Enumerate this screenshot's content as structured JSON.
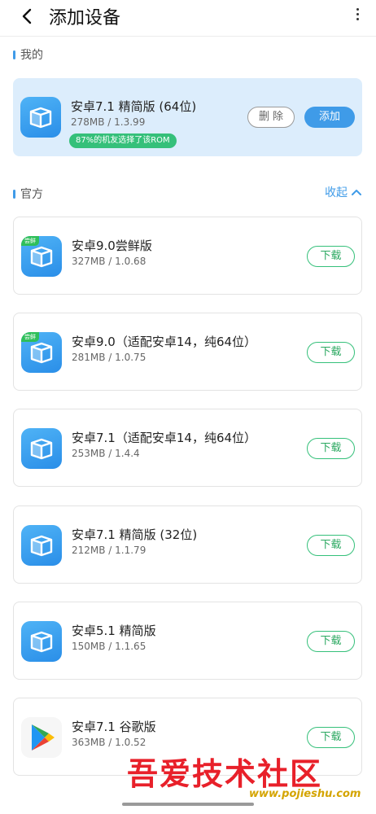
{
  "header": {
    "title": "添加设备"
  },
  "mine": {
    "section_label": "我的",
    "item": {
      "name": "安卓7.1 精简版 (64位)",
      "meta": "278MB / 1.3.99",
      "badge": "87%的机友选择了该ROM",
      "delete_label": "删除",
      "add_label": "添加"
    }
  },
  "official": {
    "section_label": "官方",
    "collapse_label": "收起",
    "beta_tag": "尝鲜",
    "download_label": "下载",
    "items": [
      {
        "name": "安卓9.0尝鲜版",
        "meta": "327MB / 1.0.68",
        "icon": "android-vm-beta-icon"
      },
      {
        "name": "安卓9.0（适配安卓14，纯64位）",
        "meta": "281MB / 1.0.75",
        "icon": "android-vm-beta-icon"
      },
      {
        "name": "安卓7.1（适配安卓14，纯64位）",
        "meta": "253MB / 1.4.4",
        "icon": "android-vm-icon"
      },
      {
        "name": "安卓7.1 精简版 (32位)",
        "meta": "212MB / 1.1.79",
        "icon": "android-vm-icon"
      },
      {
        "name": "安卓5.1 精简版",
        "meta": "150MB / 1.1.65",
        "icon": "android-vm-icon"
      },
      {
        "name": "安卓7.1 谷歌版",
        "meta": "363MB / 1.0.52",
        "icon": "google-play-icon"
      }
    ]
  },
  "watermark": {
    "text": "吾爱技术社区",
    "url": "www.pojieshu.com"
  },
  "colors": {
    "accent": "#3f9be8",
    "green": "#35c07a",
    "card_highlight": "#dcedfc"
  }
}
